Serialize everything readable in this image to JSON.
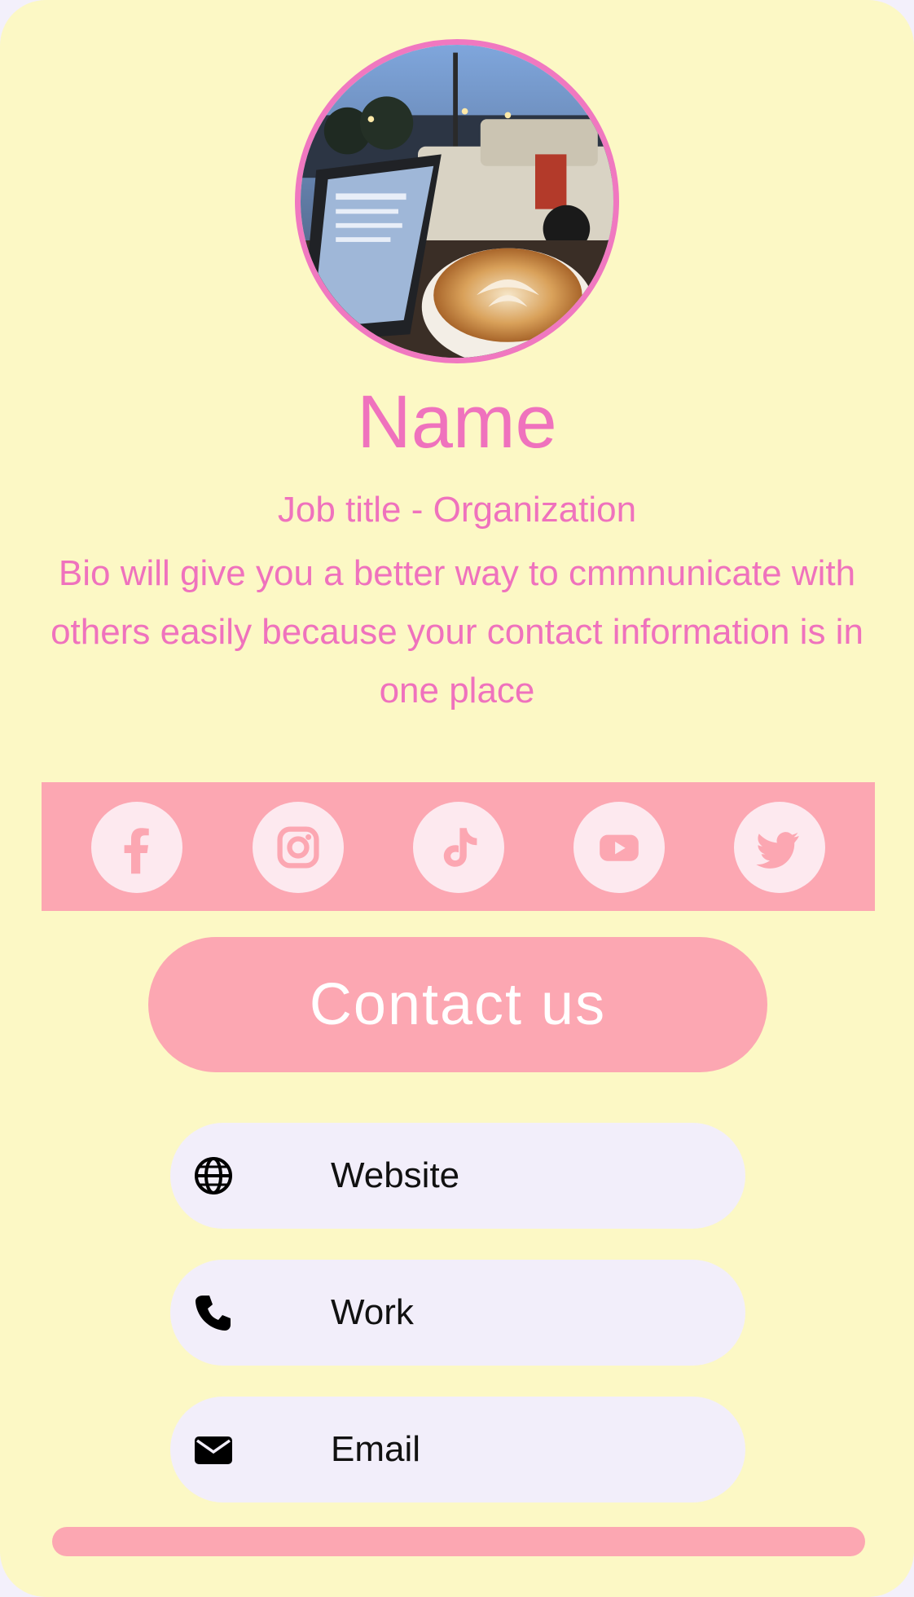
{
  "profile": {
    "photo_icon": "profile-photo-laptop-coffee",
    "name": "Name",
    "job_title": "Job title - Organization",
    "bio": "Bio will give you a better way to cmmnunicate with others easily because your contact information is in one place"
  },
  "social": [
    {
      "icon": "facebook-icon"
    },
    {
      "icon": "instagram-icon"
    },
    {
      "icon": "tiktok-icon"
    },
    {
      "icon": "youtube-icon"
    },
    {
      "icon": "twitter-icon"
    }
  ],
  "contact_button": {
    "label": "Contact us"
  },
  "contacts": [
    {
      "icon": "globe-icon",
      "label": "Website"
    },
    {
      "icon": "phone-icon",
      "label": "Work"
    },
    {
      "icon": "envelope-icon",
      "label": "Email"
    }
  ],
  "colors": {
    "background": "#fcf8c5",
    "accent_pink": "#ef72bd",
    "bar_pink": "#fca7b2",
    "pill": "#f2eefa"
  }
}
